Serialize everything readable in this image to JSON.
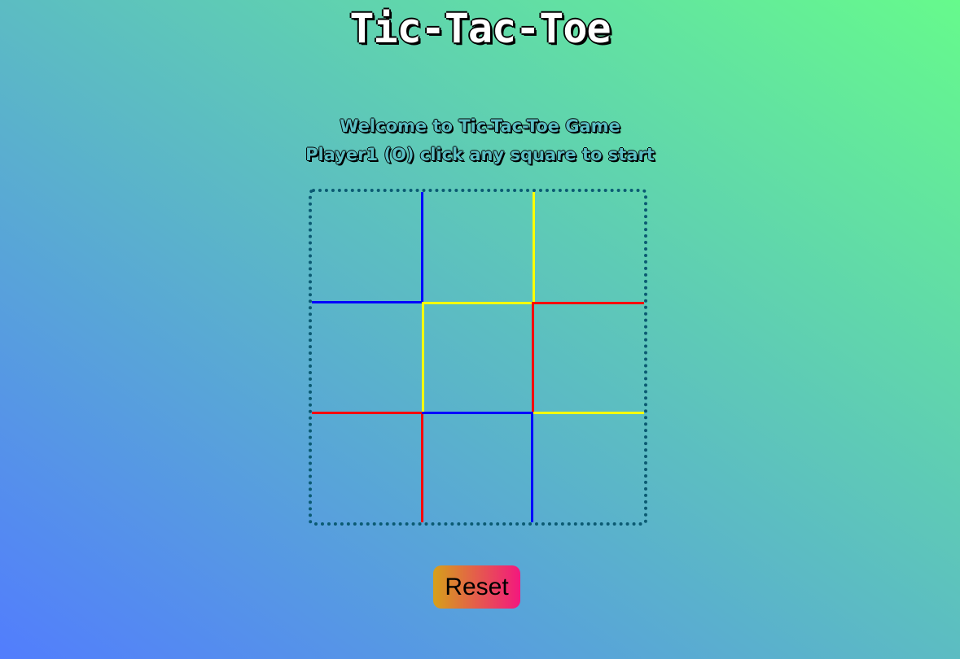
{
  "title": "Tic-Tac-Toe",
  "messages": {
    "welcome": "Welcome to Tic-Tac-Toe Game",
    "instruction": "Player1 (O) click any square to start"
  },
  "board": {
    "cells": [
      "",
      "",
      "",
      "",
      "",
      "",
      "",
      "",
      ""
    ],
    "line_colors": {
      "blue": "#0000ff",
      "yellow": "#ffff00",
      "red": "#ff0000",
      "border": "#0b5a72"
    }
  },
  "reset_button": {
    "label": "Reset"
  }
}
